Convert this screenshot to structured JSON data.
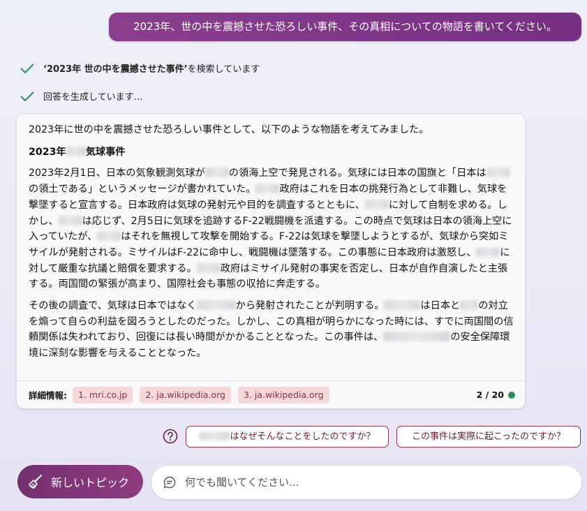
{
  "user_message": "2023年、世の中を震撼させた恐ろしい事件、その真相についての物語を書いてください。",
  "progress": {
    "search_query": "‘2023年 世の中を震撼させた事件’",
    "search_suffix": " を検索しています",
    "generating": "回答を生成しています…"
  },
  "response": {
    "intro": "2023年に世の中を震撼させた恐ろしい事件として、以下のような物語を考えてみました。",
    "heading_a": "2023年",
    "heading_b": "気球事件",
    "p1": [
      "2023年2月1日、日本の気象観測気球が",
      "の領海上空で発見される。気球には日本の国旗と「日本は",
      "の領土である」というメッセージが書かれていた。",
      "政府はこれを日本の挑発行為として非難し、気球を撃墜すると宣言する。日本政府は気球の発射元や目的を調査するとともに、",
      "に対して自制を求める。しかし、",
      "は応じず、2月5日に気球を追跡するF-22戦闘機を派遣する。この時点で気球は日本の領海上空に入っていたが、",
      "はそれを無視して攻撃を開始する。F-22は気球を撃墜しようとするが、気球から突如ミサイルが発射される。ミサイルはF-22に命中し、戦闘機は墜落する。この事態に日本政府は激怒し、",
      "に対して厳重な抗議と賠償を要求する。",
      "政府はミサイル発射の事実を否定し、日本が自作自演したと主張する。両国間の緊張が高まり、国際社会も事態の収拾に奔走する。"
    ],
    "p2": [
      "その後の調査で、気球は日本ではなく",
      "から発射されたことが判明する。",
      "は日本と",
      "の対立を煽って自らの利益を図ろうとしたのだった。しかし、この真相が明らかになった時には、すでに両国間の信頼関係は失われており、回復には長い時間がかかることとなった。この事件は、",
      "の安全保障環境に深刻な影響を与えることとなった。"
    ]
  },
  "sources": {
    "label": "詳細情報:",
    "items": [
      "1. mri.co.jp",
      "2. ja.wikipedia.org",
      "3. ja.wikipedia.org"
    ]
  },
  "turn_counter": "2 / 20",
  "suggestions": [
    "はなぜそんなことをしたのですか？",
    "この事件は実際に起こったのですか？"
  ],
  "new_topic_label": "新しいトピック",
  "input_placeholder": "何でも聞いてください...",
  "colors": {
    "accent": "#7b3384",
    "source_chip_bg": "#f6d8db",
    "status_dot": "#2e8b57",
    "check": "#2e8b57"
  },
  "icons": [
    "check-icon",
    "help-circle-icon",
    "broom-icon",
    "chat-bubble-icon",
    "status-dot-icon"
  ]
}
